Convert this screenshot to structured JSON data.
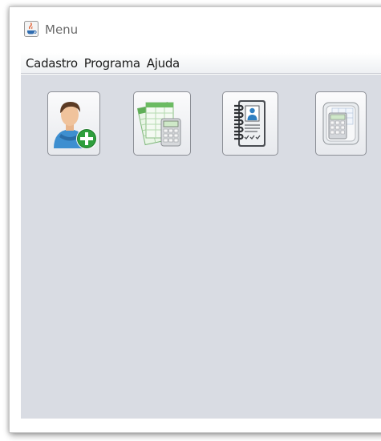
{
  "window": {
    "title": "Menu",
    "title_icon": "java-coffee-icon"
  },
  "menubar": {
    "items": [
      {
        "label": "Cadastro"
      },
      {
        "label": "Programa"
      },
      {
        "label": "Ajuda"
      }
    ]
  },
  "toolbar": {
    "buttons": [
      {
        "icon": "add-user-icon"
      },
      {
        "icon": "spreadsheet-calculator-icon"
      },
      {
        "icon": "address-book-icon"
      },
      {
        "icon": "calculator-icon"
      }
    ]
  },
  "colors": {
    "content_background": "#d9dce3",
    "add_badge": "#2e9e3c",
    "accent_blue": "#2f7fc1"
  }
}
